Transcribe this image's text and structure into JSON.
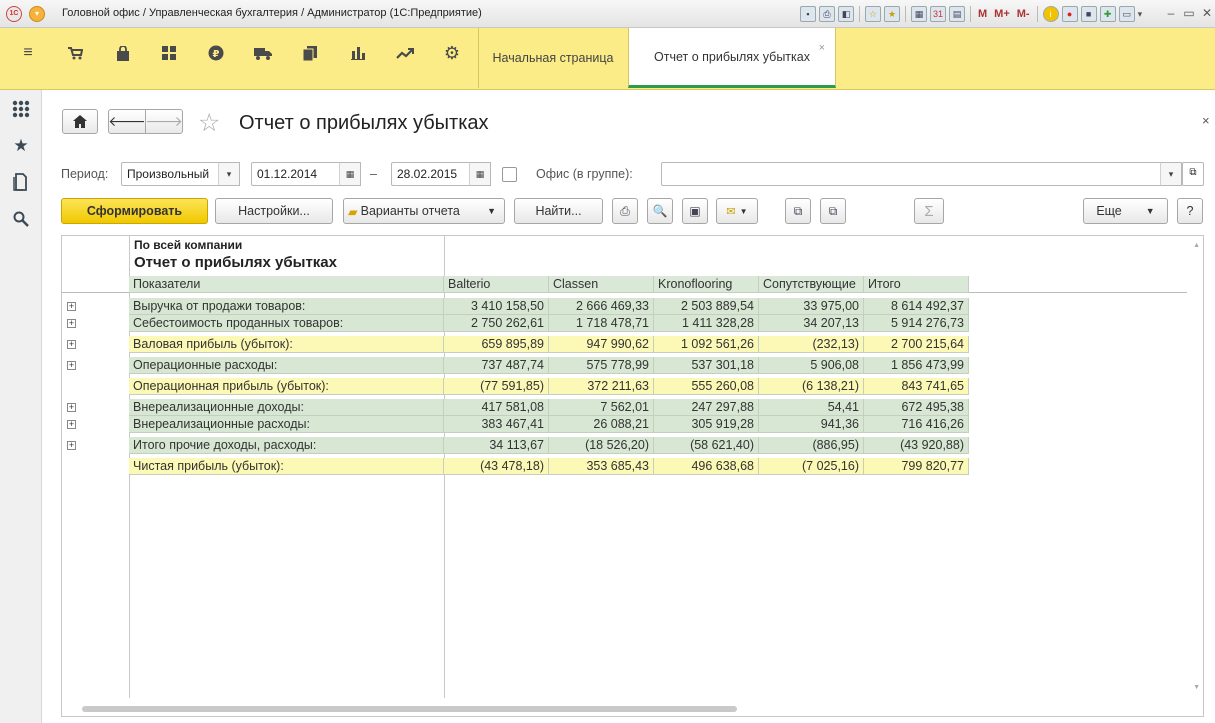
{
  "titlebar": {
    "text": "Головной офис / Управленческая бухгалтерия / Администратор  (1С:Предприятие)",
    "memory_buttons": [
      "M",
      "M+",
      "M-"
    ]
  },
  "sections": {
    "icons": [
      "menu-icon",
      "cart-icon",
      "bag-icon",
      "grid-icon",
      "ruble-icon",
      "truck-icon",
      "documents-icon",
      "bar-chart-icon",
      "trend-icon",
      "gear-icon"
    ],
    "tabs": [
      {
        "label": "Начальная страница"
      },
      {
        "label": "Отчет о прибылях убытках",
        "active": true
      }
    ],
    "close_glyph": "×"
  },
  "form": {
    "title": "Отчет о прибылях убытках",
    "close_glyph": "×",
    "period_label": "Период:",
    "period_type": "Произвольный",
    "date_from": "01.12.2014",
    "dash": "–",
    "date_to": "28.02.2015",
    "office_label": "Офис (в группе):",
    "office_value": ""
  },
  "commandbar": {
    "generate": "Сформировать",
    "settings": "Настройки...",
    "variants": "Варианты отчета",
    "find": "Найти...",
    "more": "Еще",
    "help": "?",
    "sum_glyph": "Σ"
  },
  "report": {
    "company": "По всей компании",
    "title": "Отчет о прибылях убытках",
    "columns": [
      "Показатели",
      "Balterio",
      "Classen",
      "Kronoflooring",
      "Сопутствующие",
      "Итого"
    ],
    "rows": [
      {
        "label": "Выручка от продажи товаров:",
        "values": [
          "3 410 158,50",
          "2 666 469,33",
          "2 503 889,54",
          "33 975,00",
          "8 614 492,37"
        ]
      },
      {
        "label": "Себестоимость проданных товаров:",
        "values": [
          "2 750 262,61",
          "1 718 478,71",
          "1 411 328,28",
          "34 207,13",
          "5 914 276,73"
        ]
      },
      {
        "label": "Валовая прибыль (убыток):",
        "values": [
          "659 895,89",
          "947 990,62",
          "1 092 561,26",
          "(232,13)",
          "2 700 215,64"
        ]
      },
      {
        "label": "Операционные расходы:",
        "values": [
          "737 487,74",
          "575 778,99",
          "537 301,18",
          "5 906,08",
          "1 856 473,99"
        ]
      },
      {
        "label": "Операционная прибыль (убыток):",
        "values": [
          "(77 591,85)",
          "372 211,63",
          "555 260,08",
          "(6 138,21)",
          "843 741,65"
        ]
      },
      {
        "label": "Внереализационные доходы:",
        "values": [
          "417 581,08",
          "7 562,01",
          "247 297,88",
          "54,41",
          "672 495,38"
        ]
      },
      {
        "label": "Внереализационные расходы:",
        "values": [
          "383 467,41",
          "26 088,21",
          "305 919,28",
          "941,36",
          "716 416,26"
        ]
      },
      {
        "label": "Итого прочие доходы, расходы:",
        "values": [
          "34 113,67",
          "(18 526,20)",
          "(58 621,40)",
          "(886,95)",
          "(43 920,88)"
        ]
      },
      {
        "label": "Чистая прибыль (убыток):",
        "values": [
          "(43 478,18)",
          "353 685,43",
          "496 638,68",
          "(7 025,16)",
          "799 820,77"
        ]
      }
    ]
  },
  "colors": {
    "section_bar": "#fbec88",
    "active_tab_underline": "#2e9b4a",
    "row_green": "#d7e7d4",
    "row_yellow": "#fcf8b6",
    "primary_button": "#f0c800"
  }
}
